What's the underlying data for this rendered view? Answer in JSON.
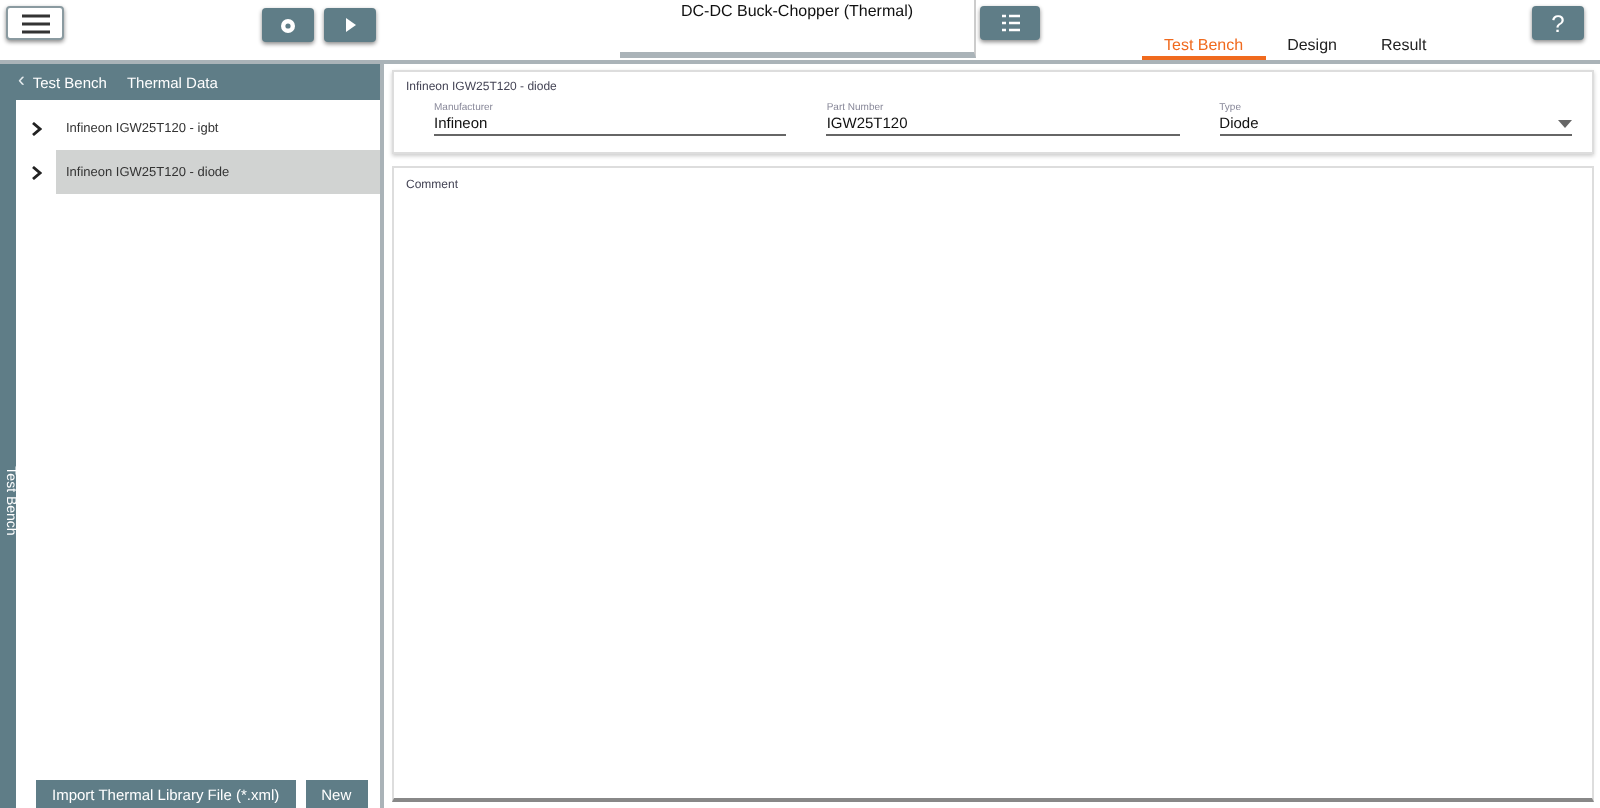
{
  "title": "DC-DC Buck-Chopper (Thermal)",
  "tabs": [
    {
      "label": "Test Bench",
      "selected": true
    },
    {
      "label": "Design",
      "selected": false
    },
    {
      "label": "Result",
      "selected": false
    }
  ],
  "help": "?",
  "sidebar": {
    "collapse": "‹",
    "breadcrumb": [
      "Test Bench",
      "Thermal Data"
    ],
    "vertical_label": "Test Bench",
    "items": [
      {
        "label": "Infineon IGW25T120 - igbt",
        "selected": false
      },
      {
        "label": "Infineon IGW25T120 - diode",
        "selected": true
      }
    ],
    "buttons": [
      "Import Thermal Library File (*.xml)",
      "New"
    ]
  },
  "card": {
    "title": "Infineon IGW25T120 - diode",
    "fields": [
      {
        "kind": "text",
        "label": "Manufacturer",
        "value": "Infineon"
      },
      {
        "kind": "text",
        "label": "Part Number",
        "value": "IGW25T120"
      },
      {
        "kind": "select",
        "label": "Type",
        "value": "Diode"
      }
    ]
  },
  "comment": {
    "label": "Comment"
  }
}
